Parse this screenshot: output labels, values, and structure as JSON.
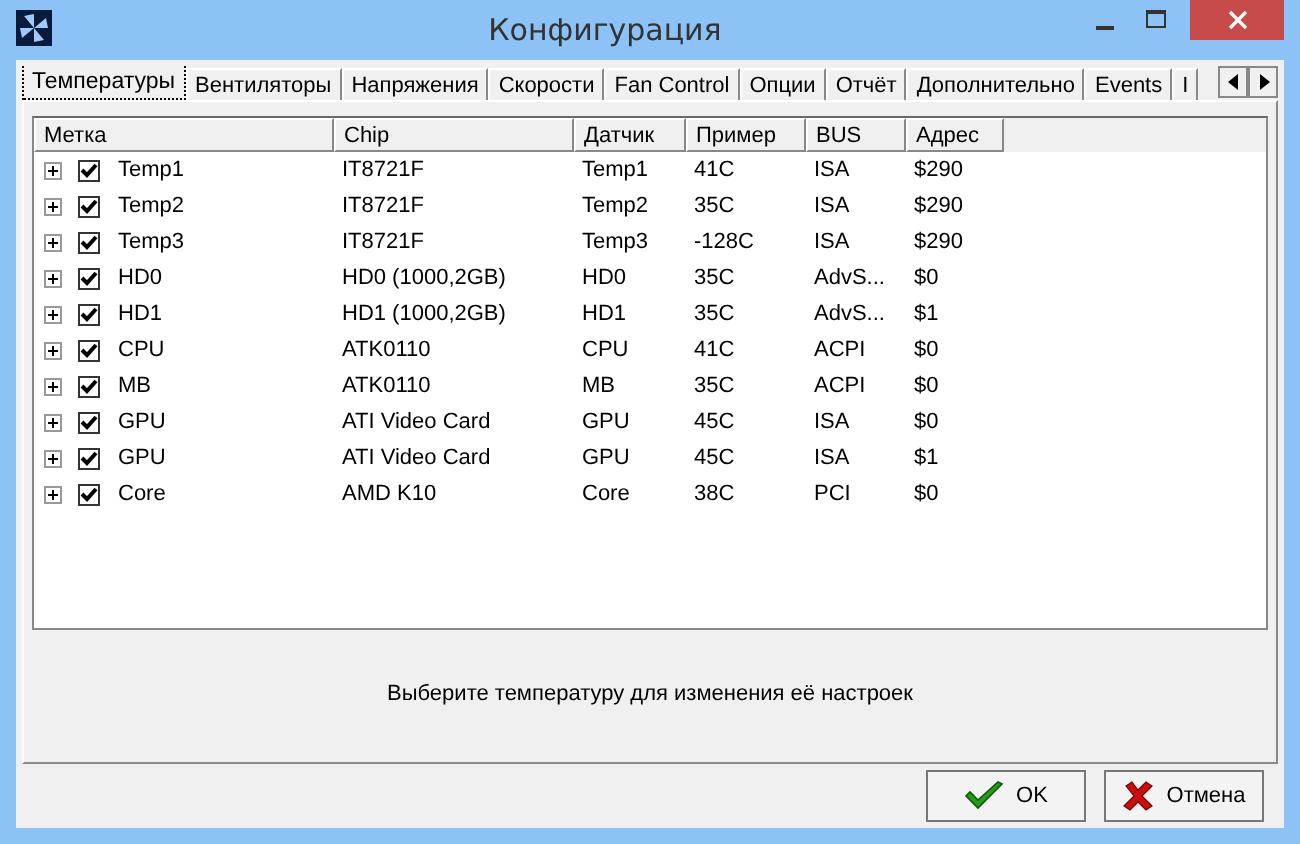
{
  "window": {
    "title": "Конфигурация"
  },
  "tabs": [
    {
      "label": "Температуры",
      "selected": true
    },
    {
      "label": "Вентиляторы",
      "selected": false
    },
    {
      "label": "Напряжения",
      "selected": false
    },
    {
      "label": "Скорости",
      "selected": false
    },
    {
      "label": "Fan Control",
      "selected": false
    },
    {
      "label": "Опции",
      "selected": false
    },
    {
      "label": "Отчёт",
      "selected": false
    },
    {
      "label": "Дополнительно",
      "selected": false
    },
    {
      "label": "Events",
      "selected": false
    },
    {
      "label": "I",
      "selected": false
    }
  ],
  "table": {
    "columns": [
      "Метка",
      "Chip",
      "Датчик",
      "Пример",
      "BUS",
      "Адрес"
    ],
    "rows": [
      {
        "checked": true,
        "expanded": false,
        "cells": [
          "Temp1",
          "IT8721F",
          "Temp1",
          "41C",
          "ISA",
          "$290"
        ]
      },
      {
        "checked": true,
        "expanded": false,
        "cells": [
          "Temp2",
          "IT8721F",
          "Temp2",
          "35C",
          "ISA",
          "$290"
        ]
      },
      {
        "checked": true,
        "expanded": false,
        "cells": [
          "Temp3",
          "IT8721F",
          "Temp3",
          "-128C",
          "ISA",
          "$290"
        ]
      },
      {
        "checked": true,
        "expanded": false,
        "cells": [
          "HD0",
          "HD0 (1000,2GB)",
          "HD0",
          "35C",
          "AdvS...",
          "$0"
        ]
      },
      {
        "checked": true,
        "expanded": false,
        "cells": [
          "HD1",
          "HD1 (1000,2GB)",
          "HD1",
          "35C",
          "AdvS...",
          "$1"
        ]
      },
      {
        "checked": true,
        "expanded": false,
        "cells": [
          "CPU",
          "ATK0110",
          "CPU",
          "41C",
          "ACPI",
          "$0"
        ]
      },
      {
        "checked": true,
        "expanded": false,
        "cells": [
          "MB",
          "ATK0110",
          "MB",
          "35C",
          "ACPI",
          "$0"
        ]
      },
      {
        "checked": true,
        "expanded": false,
        "cells": [
          "GPU",
          "ATI Video Card",
          "GPU",
          "45C",
          "ISA",
          "$0"
        ]
      },
      {
        "checked": true,
        "expanded": false,
        "cells": [
          "GPU",
          "ATI Video Card",
          "GPU",
          "45C",
          "ISA",
          "$1"
        ]
      },
      {
        "checked": true,
        "expanded": false,
        "cells": [
          "Core",
          "AMD K10",
          "Core",
          "38C",
          "PCI",
          "$0"
        ]
      }
    ]
  },
  "hint": "Выберите температуру для изменения её настроек",
  "buttons": [
    {
      "kind": "ok",
      "label": "OK"
    },
    {
      "kind": "cancel",
      "label": "Отмена"
    }
  ]
}
